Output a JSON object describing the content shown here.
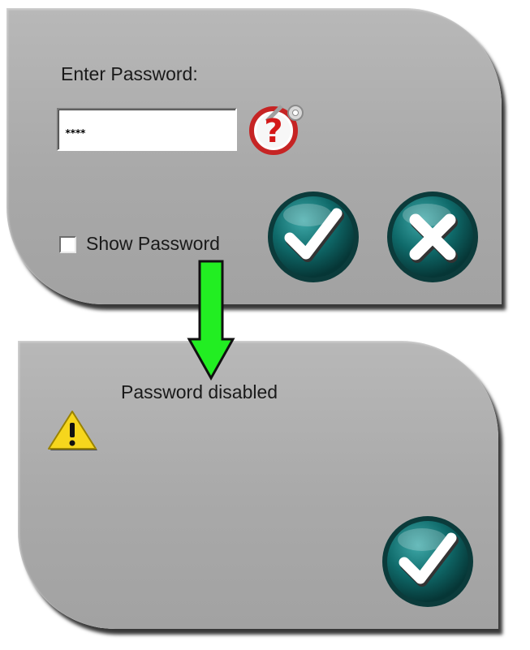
{
  "password_dialog": {
    "prompt_label": "Enter Password:",
    "password_value": "****",
    "show_password_label": "Show Password",
    "show_password_checked": false,
    "help_icon": "help-key-icon",
    "ok_icon": "checkmark-icon",
    "cancel_icon": "close-x-icon"
  },
  "disabled_dialog": {
    "message": "Password disabled",
    "warning_icon": "warning-icon",
    "ok_icon": "checkmark-icon"
  },
  "transition_icon": "arrow-down-icon",
  "colors": {
    "panel_gray": "#a9a9a9",
    "button_teal": "#0f6a6a",
    "arrow_green": "#22ee22",
    "warning_yellow": "#f5d200",
    "help_red": "#cc1111"
  }
}
